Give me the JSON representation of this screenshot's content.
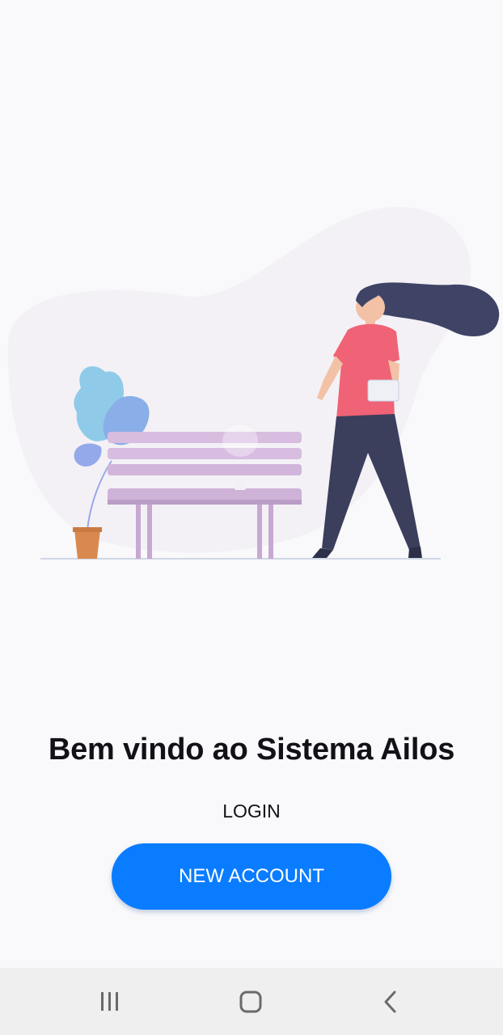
{
  "welcome": {
    "title": "Bem vindo ao Sistema Ailos"
  },
  "actions": {
    "login_label": "LOGIN",
    "new_account_label": "NEW ACCOUNT"
  },
  "nav_bar": {
    "items": [
      {
        "icon": "recent-apps-icon"
      },
      {
        "icon": "home-icon"
      },
      {
        "icon": "back-icon"
      }
    ]
  },
  "colors": {
    "background": "#f9f9fb",
    "primary_button": "#0a7cff",
    "button_text": "#ffffff",
    "title_text": "#111118",
    "nav_bar": "#efefef"
  }
}
